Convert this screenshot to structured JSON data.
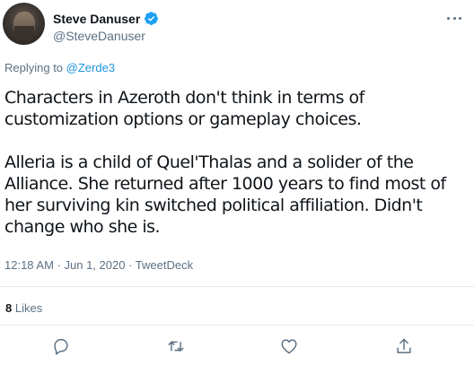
{
  "author": {
    "display_name": "Steve Danuser",
    "handle": "@SteveDanuser",
    "verified": true
  },
  "reply": {
    "prefix": "Replying to",
    "mention": "@Zerde3"
  },
  "tweet": {
    "paragraph_1": "Characters in Azeroth don't think in terms of customization options or gameplay choices.",
    "paragraph_2": "Alleria is a child of Quel'Thalas and a solider of the Alliance. She returned after 1000 years to find most of her surviving kin switched political affiliation. Didn't change who she is."
  },
  "meta": {
    "time": "12:18 AM",
    "separator_1": " · ",
    "date": "Jun 1, 2020",
    "separator_2": " · ",
    "source": "TweetDeck"
  },
  "stats": {
    "likes_count": "8",
    "likes_label": "Likes"
  },
  "actions": [
    {
      "icon": "reply-icon"
    },
    {
      "icon": "retweet-icon"
    },
    {
      "icon": "like-icon"
    },
    {
      "icon": "share-icon"
    }
  ],
  "colors": {
    "verified": "#1da1f2",
    "link": "#1b95e0",
    "secondary_text": "#5b7083"
  }
}
